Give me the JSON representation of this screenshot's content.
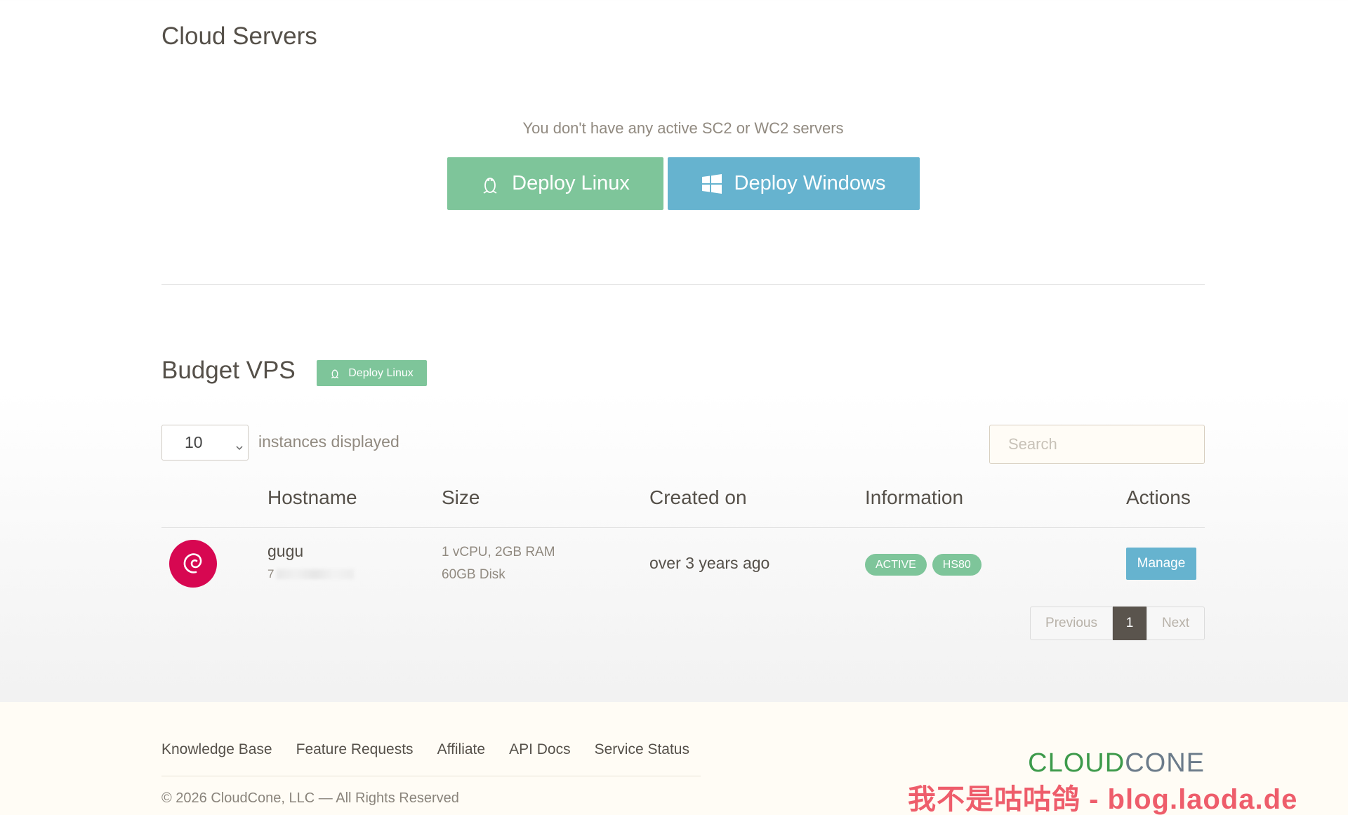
{
  "cloud_servers": {
    "title": "Cloud Servers",
    "empty_message": "You don't have any active SC2 or WC2 servers",
    "deploy_linux_label": "Deploy Linux",
    "deploy_windows_label": "Deploy Windows"
  },
  "budget_vps": {
    "title": "Budget VPS",
    "deploy_linux_label": "Deploy Linux",
    "page_length_value": "10",
    "page_length_label": "instances displayed",
    "search_placeholder": "Search",
    "columns": [
      "",
      "Hostname",
      "Size",
      "Created on",
      "Information",
      "Actions"
    ],
    "rows": [
      {
        "os_icon": "debian-icon",
        "hostname": "gugu",
        "ip_prefix": "7",
        "size_line1": "1 vCPU, 2GB RAM",
        "size_line2": "60GB Disk",
        "created": "over 3 years ago",
        "badges": [
          "ACTIVE",
          "HS80"
        ],
        "action_label": "Manage"
      }
    ],
    "pagination": {
      "previous": "Previous",
      "current": "1",
      "next": "Next"
    }
  },
  "footer": {
    "links": [
      "Knowledge Base",
      "Feature Requests",
      "Affiliate",
      "API Docs",
      "Service Status"
    ],
    "copyright": "© 2026 CloudCone, LLC — All Rights Reserved",
    "brand_part1": "CLOUD",
    "brand_part2": "CONE"
  },
  "watermark": "我不是咕咕鸽 - blog.laoda.de",
  "colors": {
    "linux_green": "#7ec59a",
    "windows_blue": "#66b3cf",
    "debian_red": "#d70751",
    "pager_active": "#5a544d"
  }
}
